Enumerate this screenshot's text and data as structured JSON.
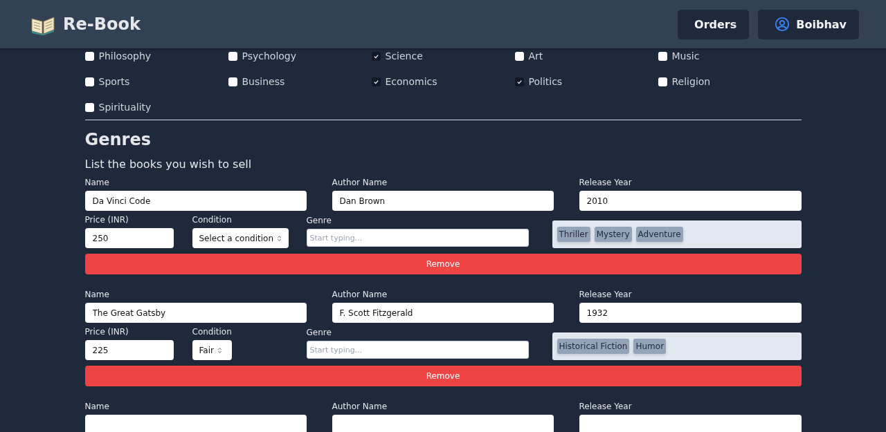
{
  "header": {
    "logo": "Re-Book",
    "nav": [
      {
        "label": "Orders",
        "kind": "link"
      },
      {
        "label": "Boibhav",
        "kind": "user"
      }
    ]
  },
  "categories": [
    {
      "label": "Philosophy",
      "checked": false
    },
    {
      "label": "Psychology",
      "checked": false
    },
    {
      "label": "Science",
      "checked": true
    },
    {
      "label": "Art",
      "checked": false
    },
    {
      "label": "Music",
      "checked": false
    },
    {
      "label": "Sports",
      "checked": false
    },
    {
      "label": "Business",
      "checked": false
    },
    {
      "label": "Economics",
      "checked": true
    },
    {
      "label": "Politics",
      "checked": true
    },
    {
      "label": "Religion",
      "checked": false
    },
    {
      "label": "Spirituality",
      "checked": false
    }
  ],
  "section_title": "Genres",
  "subtitle": "List the books you wish to sell",
  "books": [
    {
      "name_label": "Name",
      "name": "Da Vinci Code",
      "author_label": "Author Name",
      "author": "Dan Brown",
      "year_label": "Release Year",
      "year": "2010",
      "price_label": "Price (INR)",
      "price": "250",
      "condition_label": "Condition",
      "condition": "Select a condition",
      "genre_label": "Genre",
      "genre_placeholder": "Start typing...",
      "genres": [
        "Thriller",
        "Mystery",
        "Adventure"
      ],
      "remove": "Remove"
    },
    {
      "name_label": "Name",
      "name": "The Great Gatsby",
      "author_label": "Author Name",
      "author": "F. Scott Fitzgerald",
      "year_label": "Release Year",
      "year": "1932",
      "price_label": "Price (INR)",
      "price": "225",
      "condition_label": "Condition",
      "condition": "Fair",
      "genre_label": "Genre",
      "genre_placeholder": "Start typing...",
      "genres": [
        "Historical Fiction",
        "Humor"
      ],
      "remove": "Remove"
    },
    {
      "name_label": "Name",
      "author_label": "Author Name",
      "year_label": "Release Year"
    }
  ]
}
